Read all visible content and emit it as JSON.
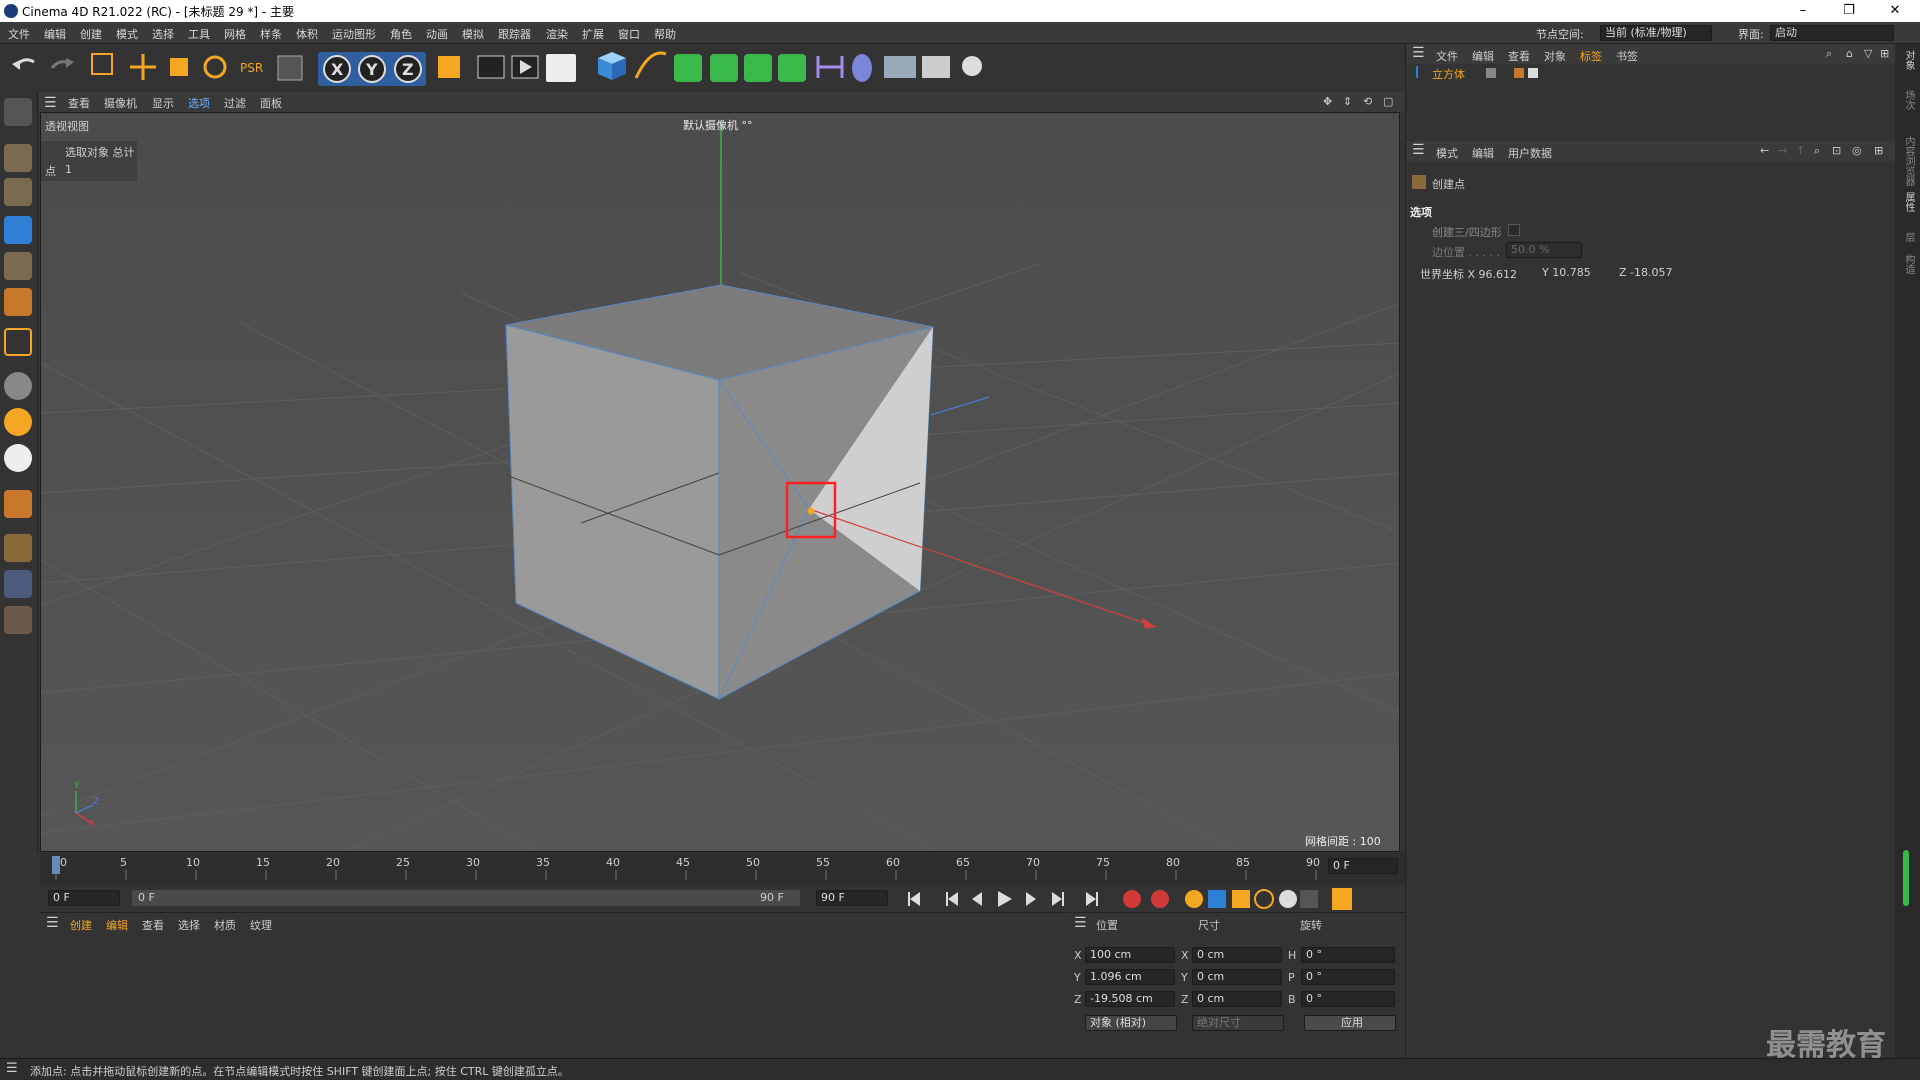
{
  "window": {
    "title": "Cinema 4D R21.022 (RC) - [未标题 29 *] - 主要",
    "min": "–",
    "max": "❐",
    "close": "✕"
  },
  "menu": [
    "文件",
    "编辑",
    "创建",
    "模式",
    "选择",
    "工具",
    "网格",
    "样条",
    "体积",
    "运动图形",
    "角色",
    "动画",
    "模拟",
    "跟踪器",
    "渲染",
    "扩展",
    "窗口",
    "帮助"
  ],
  "top_right": {
    "node_space_label": "节点空间:",
    "node_space_value": "当前 (标准/物理)",
    "layout_label": "界面:",
    "layout_value": "启动"
  },
  "viewport": {
    "menu": [
      "查看",
      "摄像机",
      "显示",
      "选项",
      "过滤",
      "面板"
    ],
    "title": "透视视图",
    "camera": "默认摄像机 °°",
    "hud_header": "选取对象 总计",
    "hud_row_label": "点",
    "hud_row_value": "1",
    "grid_spacing": "网格间距 : 100 cm",
    "axis_y": "Y",
    "axis_z": "Z",
    "axis_x": "X"
  },
  "timeline": {
    "ticks": [
      "0",
      "5",
      "10",
      "15",
      "20",
      "25",
      "30",
      "35",
      "40",
      "45",
      "50",
      "55",
      "60",
      "65",
      "70",
      "75",
      "80",
      "85",
      "90"
    ],
    "current_frame": "0 F",
    "start": "0 F",
    "range_start": "0 F",
    "range_end": "90 F",
    "end": "90 F"
  },
  "material": {
    "menu": [
      "创建",
      "编辑",
      "查看",
      "选择",
      "材质",
      "纹理"
    ]
  },
  "coords": {
    "headers": [
      "位置",
      "尺寸",
      "旋转"
    ],
    "rows": [
      {
        "a": "X",
        "pos": "100 cm",
        "b": "X",
        "size": "0 cm",
        "c": "H",
        "rot": "0 °"
      },
      {
        "a": "Y",
        "pos": "1.096 cm",
        "b": "Y",
        "size": "0 cm",
        "c": "P",
        "rot": "0 °"
      },
      {
        "a": "Z",
        "pos": "-19.508 cm",
        "b": "Z",
        "size": "0 cm",
        "c": "B",
        "rot": "0 °"
      }
    ],
    "mode": "对象 (相对)",
    "size_mode": "绝对尺寸",
    "apply": "应用"
  },
  "objects": {
    "menu": [
      "文件",
      "编辑",
      "查看",
      "对象",
      "标签",
      "书签"
    ],
    "item": "立方体"
  },
  "attributes": {
    "menu": [
      "模式",
      "编辑",
      "用户数据"
    ],
    "tool_name": "创建点",
    "section": "选项",
    "opt1": "创建三/四边形",
    "opt2": "边位置 . . . . .",
    "opt2_value": "50.0 %",
    "world_x": "世界坐标 X 96.612",
    "world_y": "Y 10.785",
    "world_z": "Z -18.057"
  },
  "right_strip": [
    "对象",
    "场次",
    "内容浏览器",
    "属性",
    "层",
    "构造"
  ],
  "status": "添加点: 点击并拖动鼠标创建新的点。在节点编辑模式时按住 SHIFT 键创建面上点; 按住 CTRL 键创建孤立点。",
  "watermark": "最需教育",
  "colors": {
    "accent": "#2f7fd6",
    "selection_box": "#ff2020",
    "x_axis": "#d04040",
    "y_axis": "#40c040"
  }
}
